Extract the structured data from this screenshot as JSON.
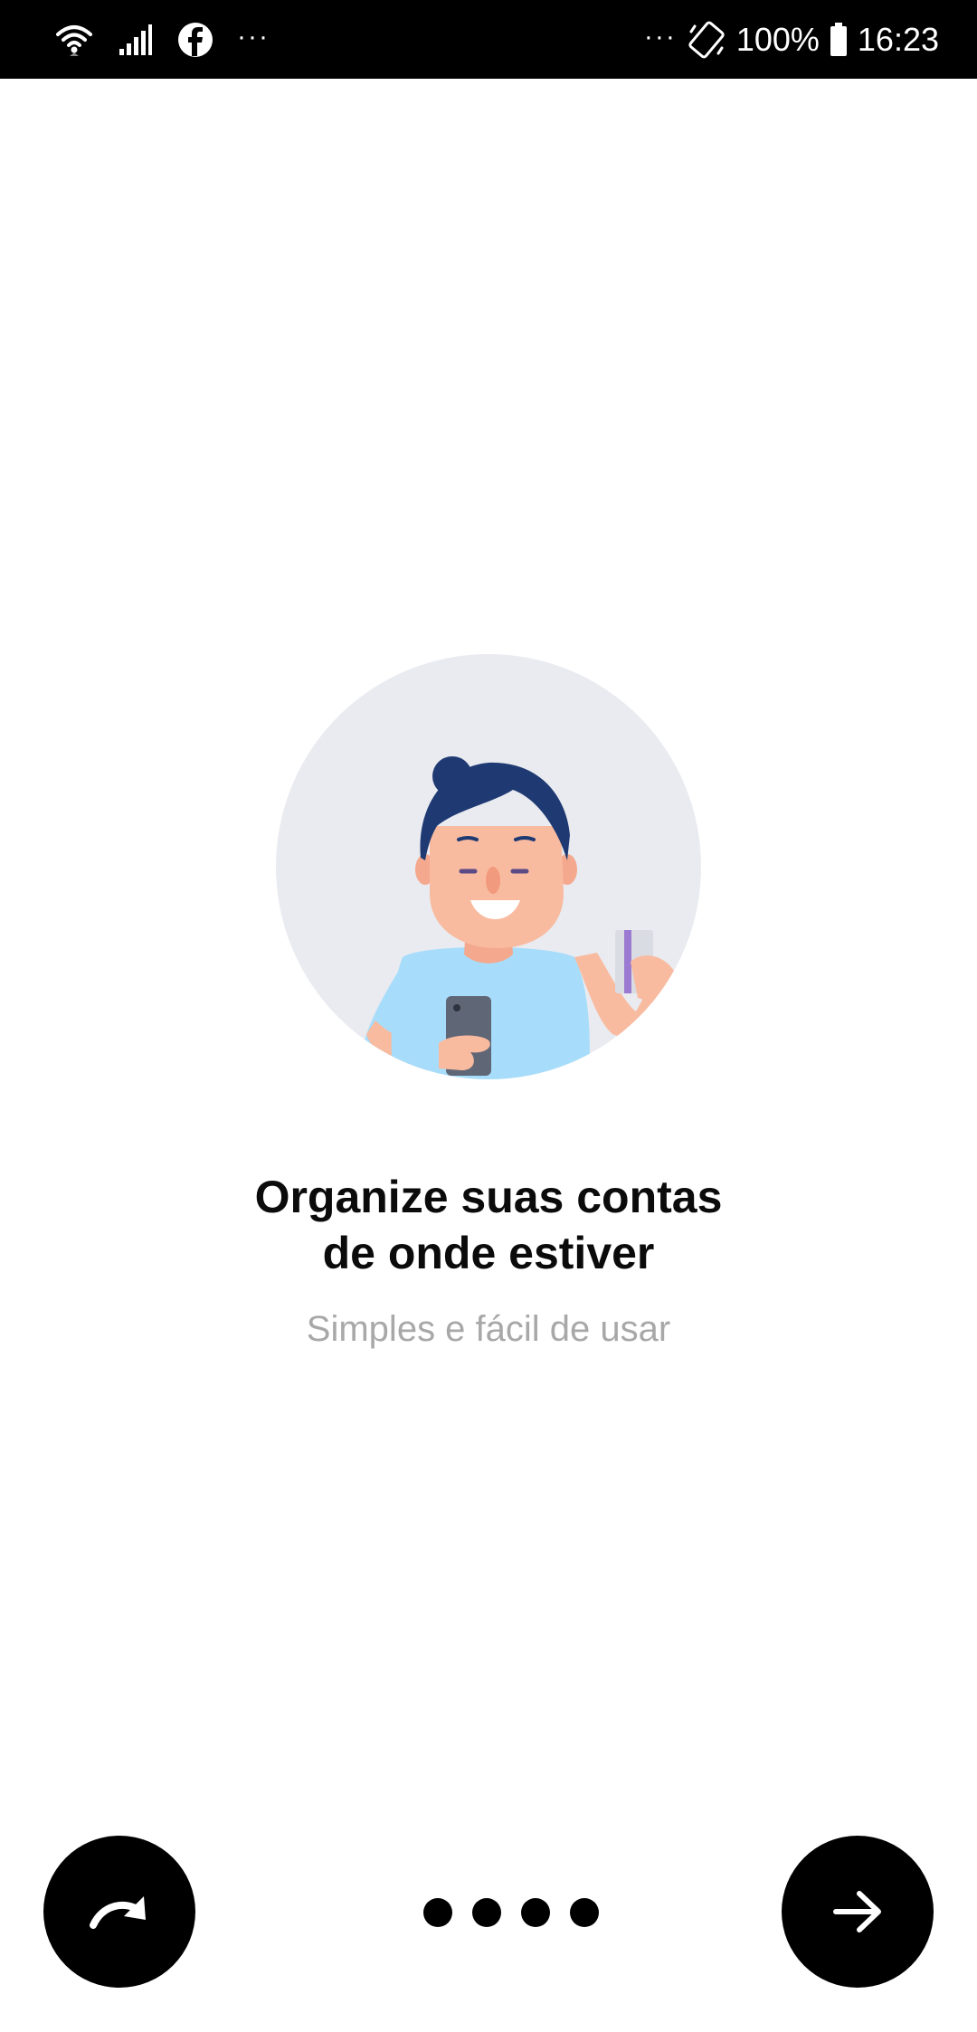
{
  "status_bar": {
    "left_dots": "···",
    "right_dots": "···",
    "battery_percent": "100%",
    "time": "16:23",
    "icons": [
      "wifi-icon",
      "signal-icon",
      "facebook-icon",
      "rotate-icon",
      "battery-icon"
    ]
  },
  "onboarding": {
    "title_line1": "Organize suas contas",
    "title_line2": "de onde estiver",
    "subtitle": "Simples e fácil de usar"
  },
  "controls": {
    "skip_icon": "redo-arrow-icon",
    "next_icon": "arrow-right-icon",
    "pager_total": 4
  },
  "colors": {
    "status_bar_bg": "#000000",
    "illustration_bg": "#E9EBF0",
    "hair": "#1F3A73",
    "skin": "#F9BBA0",
    "shirt": "#A7DDFB",
    "title": "#0B0B0B",
    "subtitle": "#A8A8A8",
    "buttons": "#000000"
  }
}
